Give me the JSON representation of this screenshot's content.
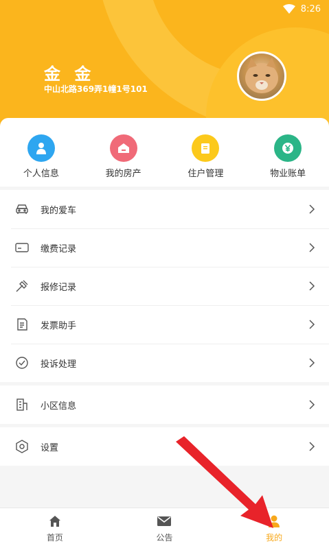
{
  "status_bar": {
    "time": "8:26",
    "wifi_icon": "wifi-icon"
  },
  "profile": {
    "name": "金 金",
    "address": "中山北路369弄1幢1号101",
    "avatar_icon": "cat-avatar"
  },
  "quick_actions": [
    {
      "label": "个人信息",
      "icon": "person-icon",
      "color": "#2ea6f0"
    },
    {
      "label": "我的房产",
      "icon": "house-icon",
      "color": "#f06a78"
    },
    {
      "label": "住户管理",
      "icon": "clipboard-icon",
      "color": "#fcc91b"
    },
    {
      "label": "物业账单",
      "icon": "yen-icon",
      "color": "#2bb587"
    }
  ],
  "menu_group1": [
    {
      "label": "我的爱车",
      "icon": "car-icon"
    },
    {
      "label": "缴费记录",
      "icon": "card-icon"
    },
    {
      "label": "报修记录",
      "icon": "wrench-icon"
    },
    {
      "label": "发票助手",
      "icon": "invoice-icon"
    },
    {
      "label": "投诉处理",
      "icon": "complaint-icon"
    }
  ],
  "menu_group2": [
    {
      "label": "小区信息",
      "icon": "building-icon"
    }
  ],
  "menu_group3": [
    {
      "label": "设置",
      "icon": "settings-icon"
    }
  ],
  "bottom_nav": [
    {
      "label": "首页",
      "icon": "home-icon",
      "active": false
    },
    {
      "label": "公告",
      "icon": "mail-icon",
      "active": false
    },
    {
      "label": "我的",
      "icon": "user-icon",
      "active": true
    }
  ],
  "colors": {
    "header": "#fbb51d",
    "accent": "#f7a81b",
    "arrow": "#e8232a"
  }
}
